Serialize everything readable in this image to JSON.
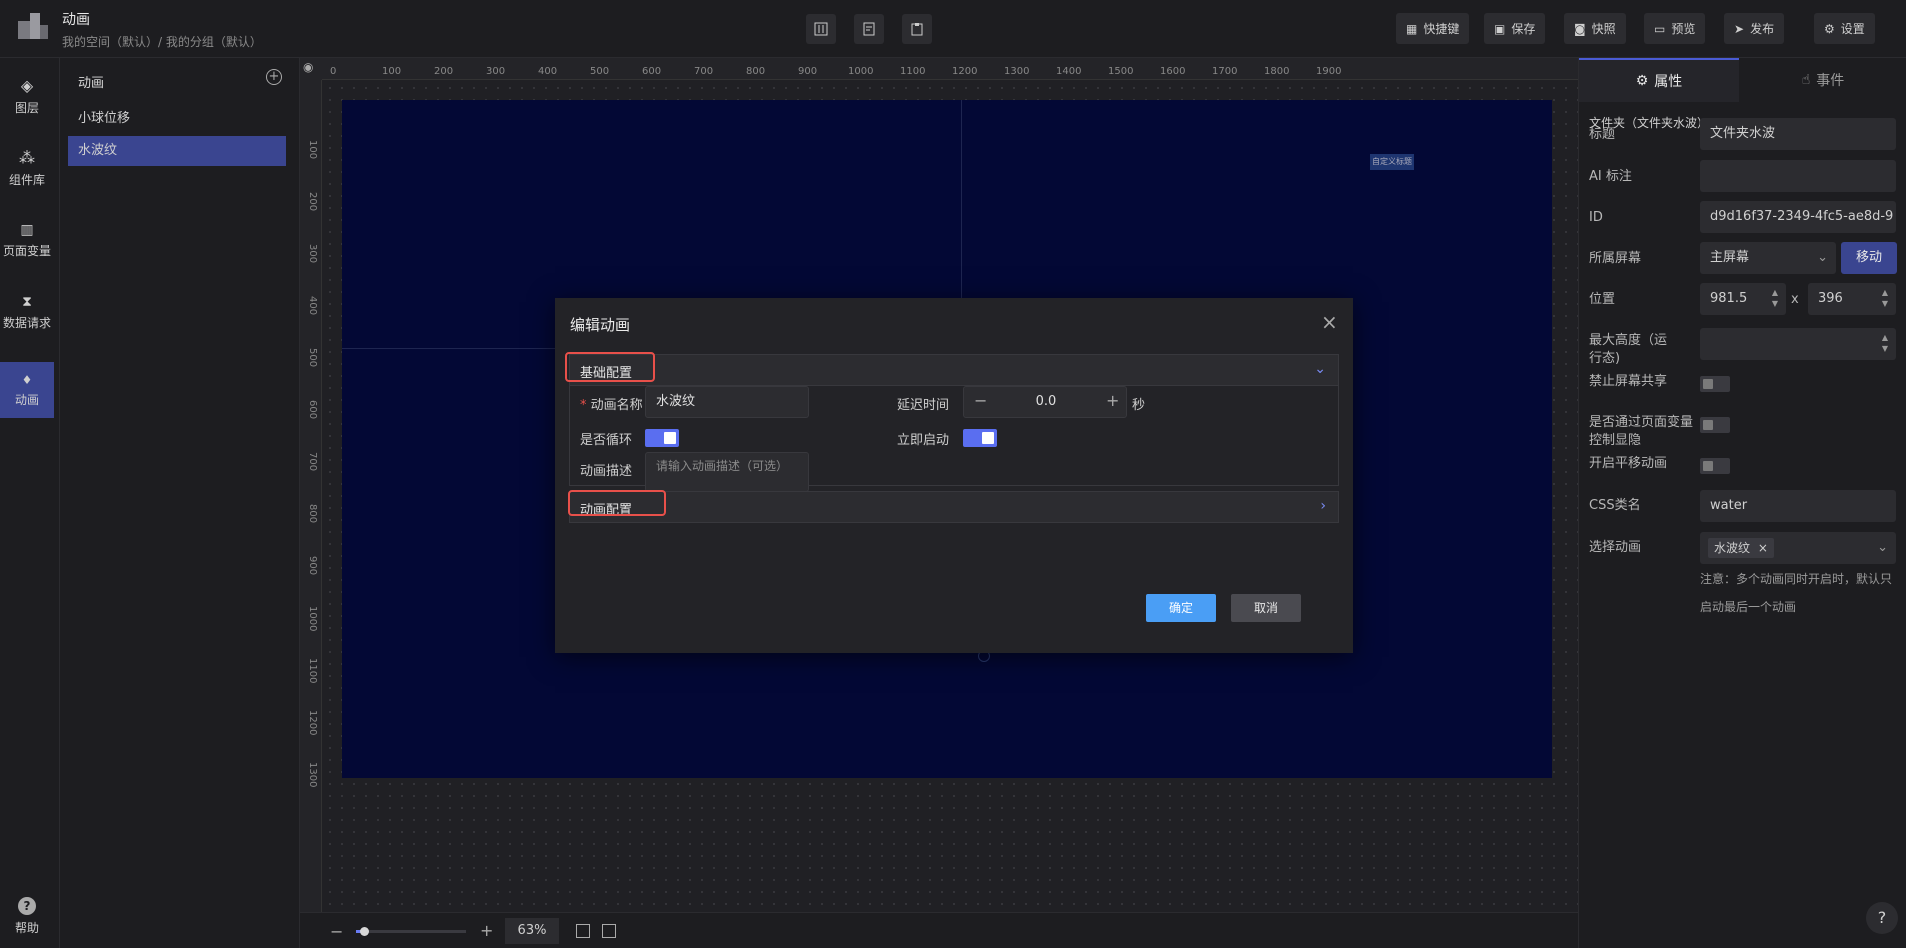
{
  "header": {
    "title": "动画",
    "breadcrumb": "我的空间（默认）/ 我的分组（默认）",
    "buttons": {
      "shortcut": "快捷键",
      "save": "保存",
      "snapshot": "快照",
      "preview": "预览",
      "publish": "发布",
      "settings": "设置"
    }
  },
  "leftnav": {
    "items": [
      {
        "label": "图层",
        "icon": "layers-icon"
      },
      {
        "label": "组件库",
        "icon": "components-icon"
      },
      {
        "label": "页面变量",
        "icon": "variable-icon"
      },
      {
        "label": "数据请求",
        "icon": "data-request-icon"
      },
      {
        "label": "动画",
        "icon": "animation-icon"
      }
    ],
    "help": "帮助"
  },
  "animpanel": {
    "title": "动画",
    "items": [
      "小球位移",
      "水波纹"
    ]
  },
  "ruler": {
    "top": [
      "0",
      "100",
      "200",
      "300",
      "400",
      "500",
      "600",
      "700",
      "800",
      "900",
      "1000",
      "1100",
      "1200",
      "1300",
      "1400",
      "1500",
      "1600",
      "1700",
      "1800",
      "1900"
    ],
    "left": [
      "100",
      "200",
      "300",
      "400",
      "500",
      "600",
      "700",
      "800",
      "900",
      "1000",
      "1100",
      "1200",
      "1300"
    ]
  },
  "canvas": {
    "label_box": "自定义标题"
  },
  "bottombar": {
    "zoom": "63%",
    "zoom_fraction": 0.07
  },
  "rightpanel": {
    "tabs": {
      "props": "属性",
      "events": "事件"
    },
    "folder": "文件夹（文件夹水波）",
    "fields": {
      "title_label": "标题",
      "title_value": "文件夹水波",
      "ai_label": "AI 标注",
      "ai_value": "",
      "id_label": "ID",
      "id_value": "d9d16f37-2349-4fc5-ae8d-9",
      "screen_label": "所属屏幕",
      "screen_value": "主屏幕",
      "move_btn": "移动",
      "pos_label": "位置",
      "pos_x": "981.5",
      "pos_sep": "x",
      "pos_y": "396",
      "maxh_label": "最大高度（运行态)",
      "share_label": "禁止屏幕共享",
      "var_label": "是否通过页面变量控制显隐",
      "pan_label": "开启平移动画",
      "css_label": "CSS类名",
      "css_value": "water",
      "anim_label": "选择动画",
      "anim_tag": "水波纹",
      "note_line1": "注意：多个动画同时开启时，默认只",
      "note_line2": "启动最后一个动画"
    }
  },
  "modal": {
    "title": "编辑动画",
    "section1": "基础配置",
    "section2": "动画配置",
    "name_label": "动画名称",
    "name_value": "水波纹",
    "delay_label": "延迟时间",
    "delay_value": "0.0",
    "delay_unit": "秒",
    "loop_label": "是否循环",
    "autostart_label": "立即启动",
    "desc_label": "动画描述",
    "desc_placeholder": "请输入动画描述（可选）",
    "ok": "确定",
    "cancel": "取消"
  },
  "colors": {
    "accent": "#3a4590",
    "primary_button": "#4a9ef5",
    "toggle_on": "#5a6ef0",
    "highlight_border": "#e8504a",
    "screen_bg": "#030835"
  }
}
